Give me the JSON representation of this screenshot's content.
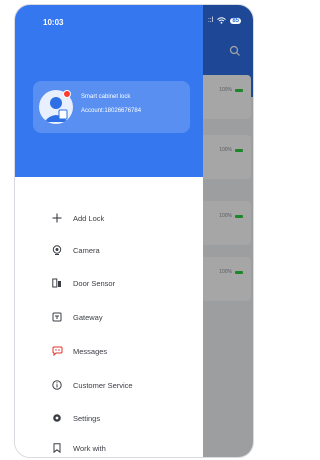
{
  "status_bar": {
    "time": "10:03",
    "signal": "::l",
    "battery": "85"
  },
  "profile": {
    "name": "Smart cabinet lock",
    "account": "Account:18026676784"
  },
  "menu": {
    "items": [
      {
        "label": "Add Lock",
        "icon": "plus-icon"
      },
      {
        "label": "Camera",
        "icon": "camera-icon"
      },
      {
        "label": "Door Sensor",
        "icon": "door-sensor-icon"
      },
      {
        "label": "Gateway",
        "icon": "gateway-icon"
      },
      {
        "label": "Messages",
        "icon": "messages-icon"
      },
      {
        "label": "Customer Service",
        "icon": "customer-service-icon"
      },
      {
        "label": "Settings",
        "icon": "settings-icon"
      },
      {
        "label": "Work with",
        "icon": "bookmark-icon"
      }
    ]
  },
  "background_list": {
    "items": [
      {
        "battery": "100%"
      },
      {
        "battery": "100%"
      },
      {
        "battery": "100%"
      },
      {
        "battery": "100%"
      }
    ]
  },
  "colors": {
    "primary": "#3477ee",
    "battery_green": "#2ecc40"
  }
}
